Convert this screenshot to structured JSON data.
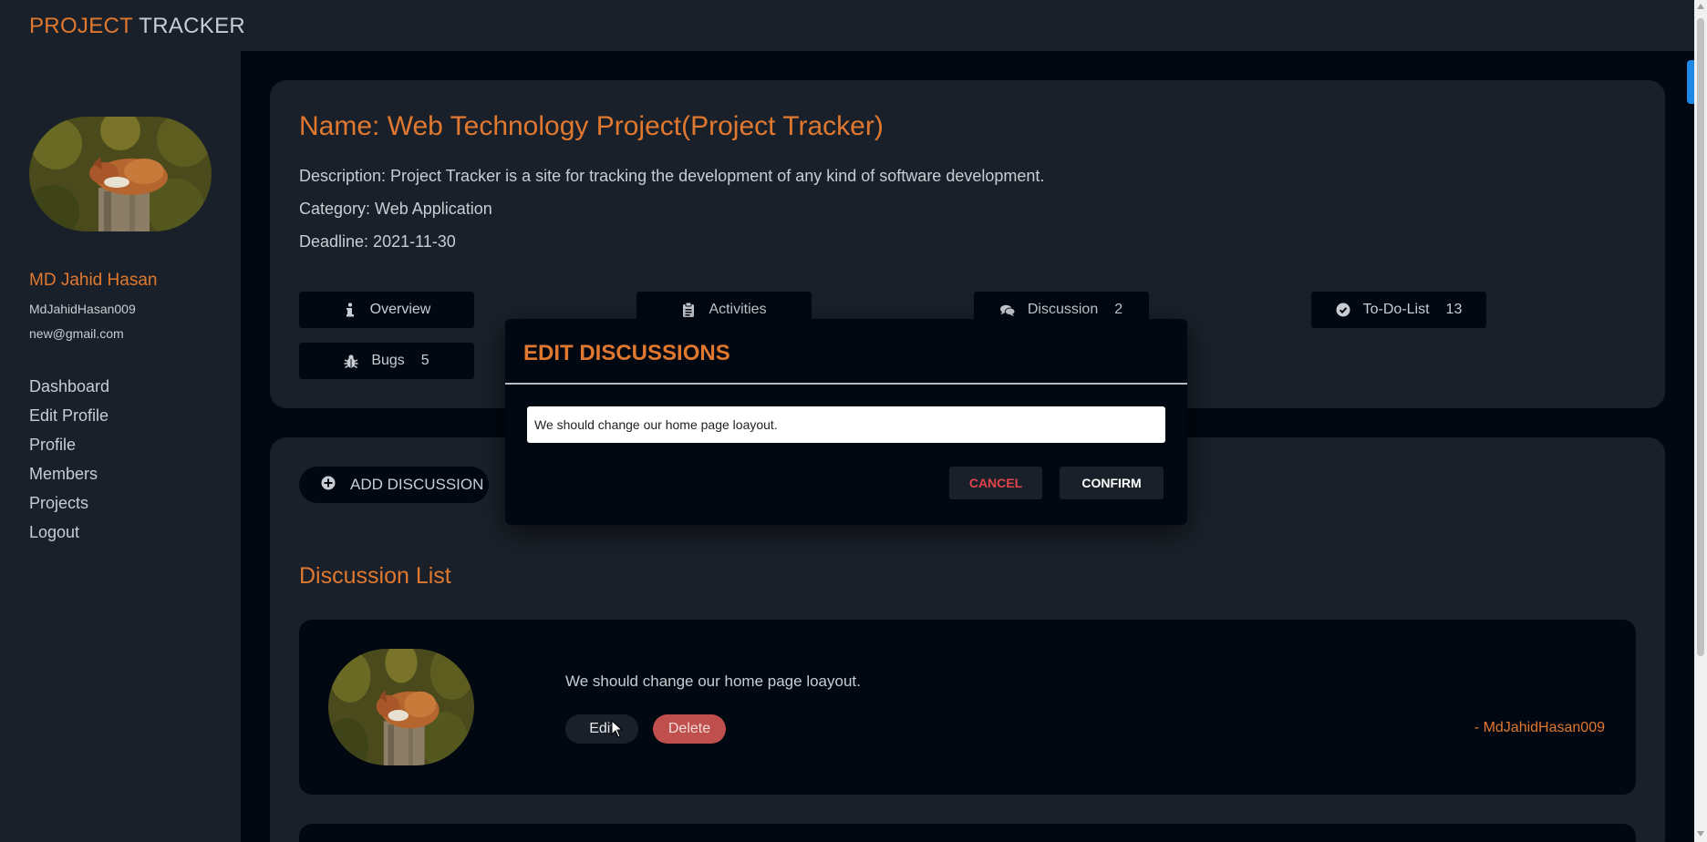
{
  "brand": {
    "part1": "PROJECT",
    "part2": "TRACKER"
  },
  "sidebar": {
    "user_name": "MD Jahid Hasan",
    "user_handle": "MdJahidHasan009",
    "user_email": "new@gmail.com",
    "items": [
      {
        "label": "Dashboard"
      },
      {
        "label": "Edit Profile"
      },
      {
        "label": "Profile"
      },
      {
        "label": "Members"
      },
      {
        "label": "Projects"
      },
      {
        "label": "Logout"
      }
    ]
  },
  "project": {
    "name": "Name: Web Technology Project(Project Tracker)",
    "description": "Description: Project Tracker is a site for tracking the development of any kind of software development.",
    "category": "Category: Web Application",
    "deadline": "Deadline: 2021-11-30"
  },
  "tabs": [
    {
      "label": "Overview",
      "icon": "info-icon",
      "count": ""
    },
    {
      "label": "Activities",
      "icon": "clipboard-icon",
      "count": ""
    },
    {
      "label": "Discussion",
      "icon": "comments-icon",
      "count": "2"
    },
    {
      "label": "To-Do-List",
      "icon": "check-circle-icon",
      "count": "13"
    },
    {
      "label": "Bugs",
      "icon": "bug-icon",
      "count": "5"
    }
  ],
  "discussion": {
    "add_label": "ADD DISCUSSION",
    "list_title": "Discussion List",
    "items": [
      {
        "text": "We should change our home page loayout.",
        "edit_label": "Edit",
        "delete_label": "Delete",
        "author": "- MdJahidHasan009"
      }
    ]
  },
  "modal": {
    "title": "EDIT DISCUSSIONS",
    "input_value": "We should change our home page loayout.",
    "cancel_label": "CANCEL",
    "confirm_label": "CONFIRM"
  },
  "colors": {
    "accent": "#e0782f",
    "panel": "#1a2029",
    "background": "#020812",
    "danger": "#c0504d"
  }
}
